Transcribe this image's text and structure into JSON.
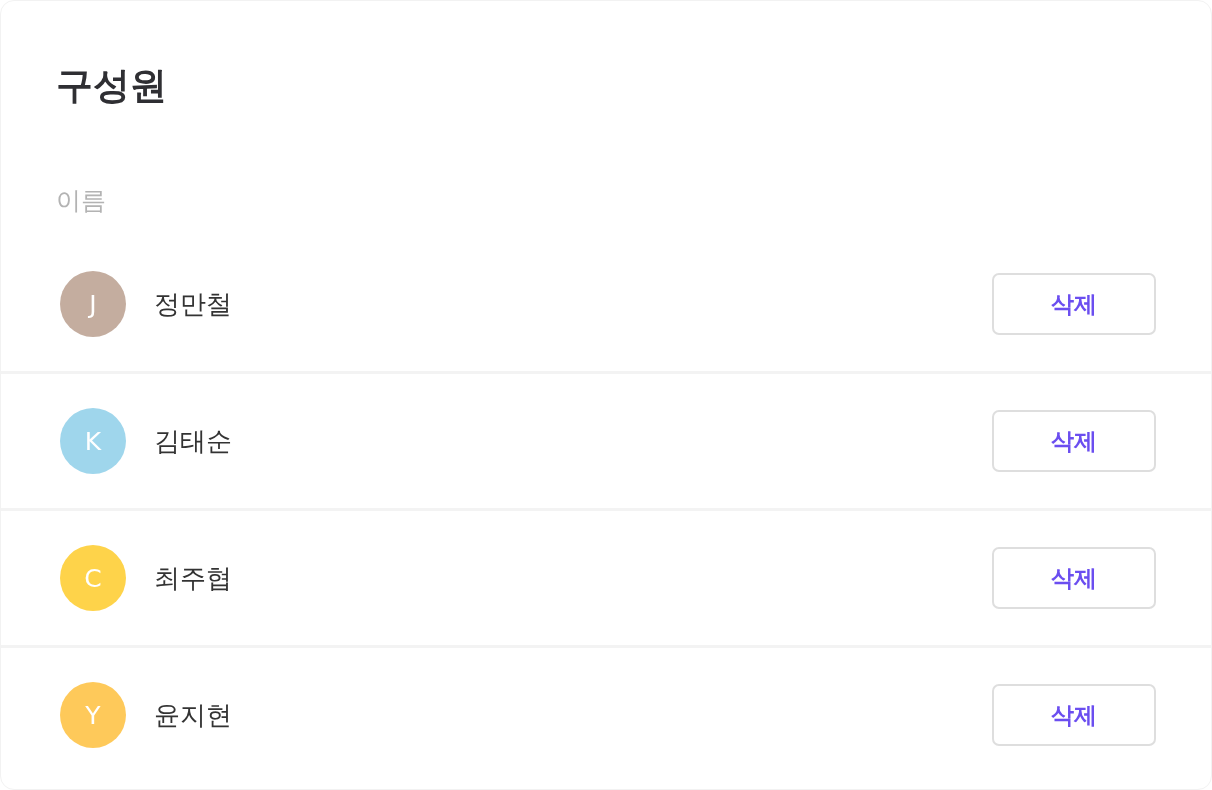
{
  "title": "구성원",
  "table": {
    "columns": [
      "이름"
    ],
    "rows": [
      {
        "avatar": {
          "initial": "J",
          "color": "#c4ad9f"
        },
        "name": "정만철",
        "action": "삭제"
      },
      {
        "avatar": {
          "initial": "K",
          "color": "#9fd6ec"
        },
        "name": "김태순",
        "action": "삭제"
      },
      {
        "avatar": {
          "initial": "C",
          "color": "#fed34a"
        },
        "name": "최주협",
        "action": "삭제"
      },
      {
        "avatar": {
          "initial": "Y",
          "color": "#fec95a"
        },
        "name": "윤지현",
        "action": "삭제"
      }
    ]
  }
}
